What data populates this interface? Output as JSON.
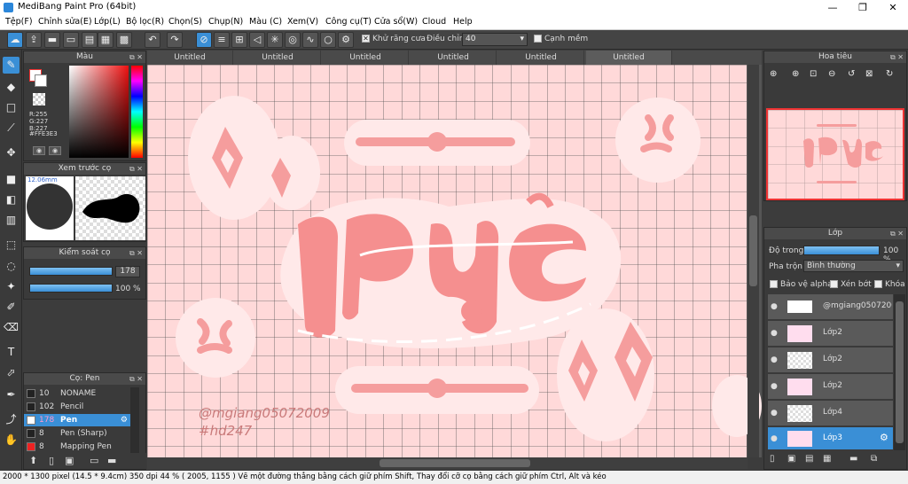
{
  "window": {
    "title": "MediBang Paint Pro (64bit)",
    "minimize": "—",
    "restore": "❐",
    "close": "✕"
  },
  "menu": [
    "Tệp(F)",
    "Chỉnh sửa(E)",
    "Lớp(L)",
    "Bộ lọc(R)",
    "Chọn(S)",
    "Chụp(N)",
    "Màu (C)",
    "Xem(V)",
    "Công cụ(T)",
    "Cửa sổ(W)",
    "Cloud",
    "Help"
  ],
  "toolbar": {
    "antialias_label": "Khử răng cưa",
    "adjust_label": "Điều chỉnh",
    "adjust_value": "40",
    "edge_label": "Cạnh mềm"
  },
  "color_panel": {
    "title": "Màu",
    "r": "R:255",
    "g": "G:227",
    "b": "B:227",
    "hex": "#FFE3E3"
  },
  "brush_preview": {
    "title": "Xem trước cọ",
    "size": "12.06mm"
  },
  "brush_control": {
    "title": "Kiểm soát cọ",
    "size_value": "178",
    "opacity_value": "100 %"
  },
  "brush_panel": {
    "title": "Cọ: Pen",
    "items": [
      {
        "size": "10",
        "name": "NONAME"
      },
      {
        "size": "102",
        "name": "Pencil"
      },
      {
        "size": "178",
        "name": "Pen"
      },
      {
        "size": "8",
        "name": "Pen (Sharp)"
      },
      {
        "size": "8",
        "name": "Mapping Pen"
      }
    ]
  },
  "doc_tabs": [
    "Untitled",
    "Untitled",
    "Untitled",
    "Untitled",
    "Untitled",
    "Untitled"
  ],
  "artwork": {
    "title_text": "rực",
    "signature": "@mgiang05072009",
    "tag": "#hd247"
  },
  "navigator": {
    "title": "Hoa tiêu"
  },
  "layer_panel": {
    "title": "Lớp",
    "opacity_label": "Độ trong",
    "opacity_value": "100 %",
    "blend_label": "Pha trộn",
    "blend_value": "Bình thường",
    "protect_alpha": "Bảo vệ alpha",
    "clipping": "Xén bớt",
    "lock": "Khóa",
    "layers": [
      "@mgiang0507200",
      "Lớp2",
      "Lớp2",
      "Lớp2",
      "Lớp4",
      "Lớp3"
    ]
  },
  "status": {
    "size": "2000 * 1300 pixel",
    "cm": "(14.5 * 9.4cm)",
    "dpi": "350 dpi",
    "zoom": "44 %",
    "coords": "( 2005, 1155 )",
    "hint": "Vẽ một đường thẳng bằng cách giữ phím Shift, Thay đổi cỡ cọ bằng cách giữ phím Ctrl, Alt và kéo"
  },
  "colors": {
    "accent": "#3a8fd6",
    "canvas_bg": "#ffe3e3",
    "pink": "#f59d9d",
    "pale": "#ffd4d4"
  }
}
